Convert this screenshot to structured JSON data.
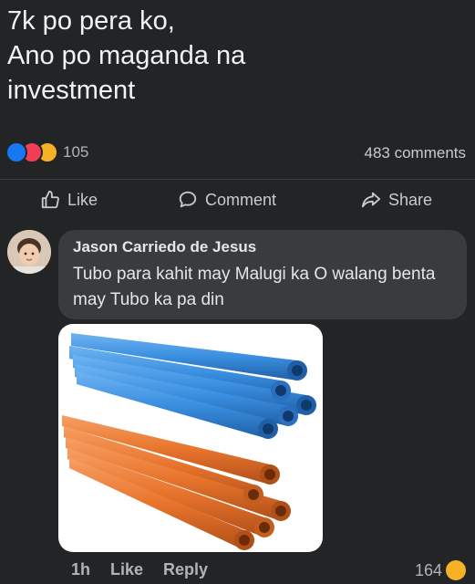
{
  "post": {
    "text": "7k po pera ko,\nAno po maganda na\ninvestment"
  },
  "reactions": {
    "count": "105",
    "icons": [
      "like-icon",
      "love-icon",
      "haha-icon"
    ]
  },
  "comments_count": "483 comments",
  "actions": {
    "like": "Like",
    "comment": "Comment",
    "share": "Share"
  },
  "comment": {
    "author": "Jason Carriedo de Jesus",
    "text": "Tubo para kahit may Malugi ka O walang benta may Tubo ka pa din",
    "time": "1h",
    "like": "Like",
    "reply": "Reply",
    "reaction_count": "164"
  },
  "colors": {
    "background": "#232426",
    "bubble": "#3a3b3c",
    "pipe_blue": "#3a8fe0",
    "pipe_orange": "#e8742c"
  }
}
